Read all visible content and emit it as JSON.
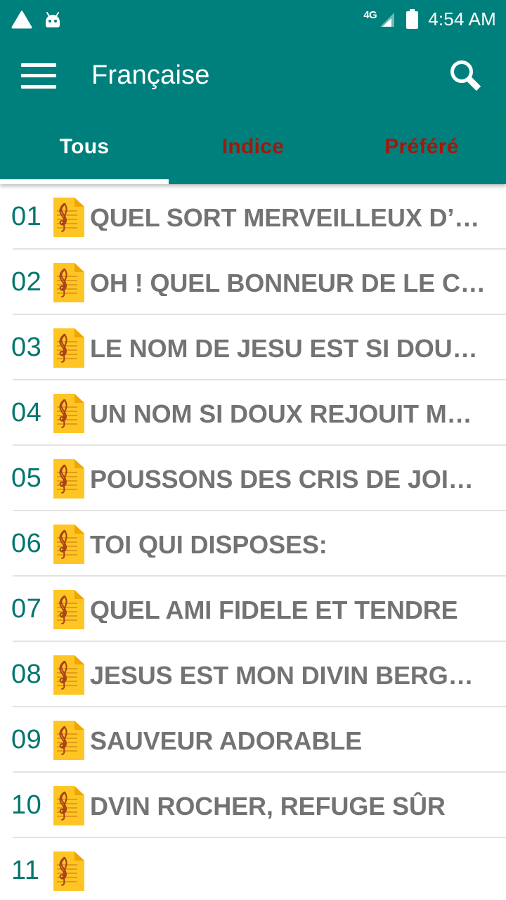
{
  "status_bar": {
    "icons_left": [
      "triangle-icon",
      "android-robot-icon"
    ],
    "network_label": "4G",
    "signal_icon": "signal-bars-icon",
    "battery_icon": "battery-full-icon",
    "time": "4:54 AM"
  },
  "app_bar": {
    "menu_icon": "hamburger-menu-icon",
    "title": "Française",
    "search_icon": "search-icon"
  },
  "tabs": {
    "active_index": 0,
    "items": [
      {
        "label": "Tous"
      },
      {
        "label": "Indice"
      },
      {
        "label": "Préféré"
      }
    ]
  },
  "list": {
    "items": [
      {
        "number": "01",
        "title": "QUEL SORT MERVEILLEUX  D’…"
      },
      {
        "number": "02",
        "title": "OH ! QUEL BONNEUR DE LE C…"
      },
      {
        "number": "03",
        "title": "LE NOM DE JESU EST SI DOU…"
      },
      {
        "number": "04",
        "title": "UN NOM SI DOUX REJOUIT M…"
      },
      {
        "number": "05",
        "title": "POUSSONS DES CRIS DE JOI…"
      },
      {
        "number": "06",
        "title": "TOI QUI DISPOSES:"
      },
      {
        "number": "07",
        "title": "QUEL AMI FIDELE ET TENDRE"
      },
      {
        "number": "08",
        "title": "JESUS EST MON DIVIN BERG…"
      },
      {
        "number": "09",
        "title": "SAUVEUR ADORABLE"
      },
      {
        "number": "10",
        "title": "DVIN ROCHER, REFUGE SÛR"
      },
      {
        "number": "11",
        "title": ""
      }
    ]
  },
  "colors": {
    "primary_teal": "#00807d",
    "number_teal": "#00766e",
    "tab_inactive_red": "#a3180d",
    "title_gray": "#737373",
    "icon_yellow": "#ffc524",
    "icon_orange": "#f5a623",
    "clef_brown": "#a8431a",
    "divider": "#e3e3e3"
  }
}
